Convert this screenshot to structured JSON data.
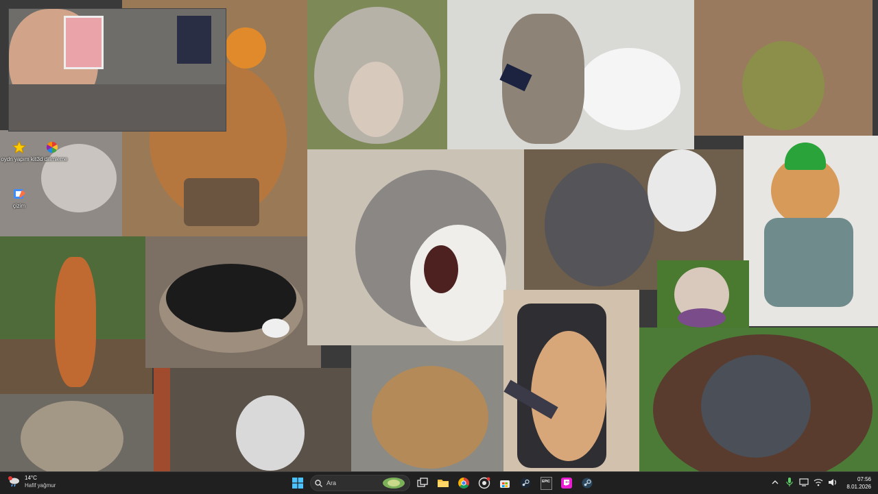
{
  "desktop_icons": [
    {
      "label": "oydn yapım kiti",
      "icon": "star-icon"
    },
    {
      "label": "3d dilimleme",
      "icon": "colorful-pinwheel-icon"
    },
    {
      "label": "çizim",
      "icon": "paint-icon"
    }
  ],
  "taskbar": {
    "weather": {
      "temp": "14°C",
      "condition": "Hafif yağmur",
      "icon": "rain-cloud-icon"
    },
    "search_placeholder": "Ara",
    "apps": [
      "windows-start-icon",
      "task-view-icon",
      "file-explorer-icon",
      "chrome-icon",
      "github-desktop-icon",
      "microsoft-store-icon",
      "steam-icon",
      "epic-games-icon",
      "twitch-icon",
      "steam-icon-2"
    ],
    "epic_label": "EPIC",
    "tray": [
      "chevron-up-icon",
      "microphone-icon",
      "display-icon",
      "wifi-icon",
      "speaker-icon"
    ],
    "time": "07:56",
    "date": "8.01.2026"
  },
  "colors": {
    "taskbar": "#202020",
    "accent_blue": "#1e90ff"
  }
}
